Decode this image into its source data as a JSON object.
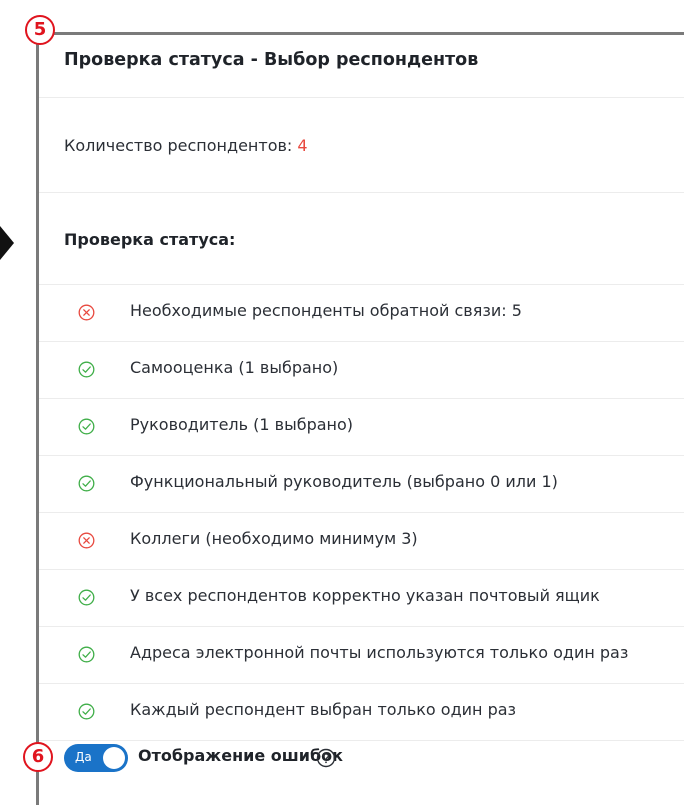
{
  "callouts": {
    "first": "5",
    "second": "6"
  },
  "panel": {
    "title": "Проверка статуса - Выбор респондентов",
    "respondent_count_label": "Количество респондентов: ",
    "respondent_count_value": "4",
    "status_heading": "Проверка статуса:"
  },
  "checks": [
    {
      "label": "Необходимые респонденты обратной связи: 5",
      "status": "error"
    },
    {
      "label": "Самооценка (1 выбрано)",
      "status": "ok"
    },
    {
      "label": "Руководитель (1 выбрано)",
      "status": "ok"
    },
    {
      "label": "Функциональный руководитель (выбрано 0 или 1)",
      "status": "ok"
    },
    {
      "label": "Коллеги (необходимо минимум 3)",
      "status": "error"
    },
    {
      "label": "У всех респондентов корректно указан почтовый ящик",
      "status": "ok"
    },
    {
      "label": "Адреса электронной почты используются только один раз",
      "status": "ok"
    },
    {
      "label": "Каждый респондент выбран только один раз",
      "status": "ok"
    }
  ],
  "show_errors": {
    "toggle_label": "Да",
    "on": true,
    "label": "Отображение ошибок"
  },
  "colors": {
    "error": "#e8493f",
    "ok": "#3fae48",
    "toggle": "#1a73c8",
    "callout": "#e0141e"
  }
}
